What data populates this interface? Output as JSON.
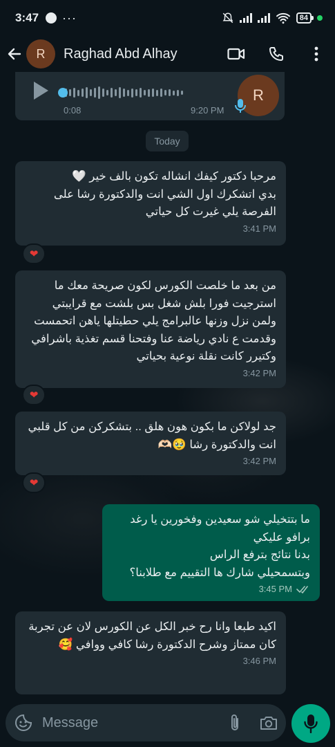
{
  "status_bar": {
    "time": "3:47",
    "dots": "···",
    "battery": "84"
  },
  "header": {
    "contact_name": "Raghad Abd Alhay",
    "avatar_letter": "R"
  },
  "voice_message": {
    "duration": "0:08",
    "time": "9:20 PM",
    "avatar_letter": "R"
  },
  "date_chip": "Today",
  "messages": [
    {
      "direction": "in",
      "text": "مرحبا دكتور كيفك انشاله تكون بالف خير 🤍\nبدي اتشكرك اول الشي انت والدكتورة رشا على الفرصة يلي غيرت كل حياتي",
      "time": "3:41 PM",
      "reaction": "❤"
    },
    {
      "direction": "in",
      "text": "من بعد ما خلصت الكورس لكون صريحة معك ما استرجيت فورا بلش شغل بس بلشت مع قرايبتي ولمن نزل وزنها عالبرامج يلي حطيتلها ياهن اتحمست وقدمت ع نادي رياضة عنا وفتحنا قسم تغذية باشرافي وكتيرر كانت نقلة نوعية بحياتي",
      "time": "3:42 PM",
      "reaction": "❤"
    },
    {
      "direction": "in",
      "text": "جد لولاكن ما بكون هون هلق .. بتشكركن من كل قلبي انت والدكتورة رشا 🥹🫶🏻",
      "time": "3:42 PM",
      "reaction": "❤"
    },
    {
      "direction": "out",
      "text": "ما بتتخيلي شو سعيدين وفخورين يا رغد\nبرافو عليكي\nبدنا نتائج بترفع الراس\nوبتسمحيلي شارك ها التقييم مع طلابنا؟",
      "time": "3:45 PM"
    },
    {
      "direction": "in",
      "text": "اكيد طبعا وانا رح خبر الكل عن الكورس لان عن تجربة كان ممتاز وشرح الدكتورة رشا كافي ووافي 🥰",
      "time": "3:46 PM"
    }
  ],
  "composer": {
    "placeholder": "Message"
  },
  "colors": {
    "background": "#0b141a",
    "incoming_bubble": "#202c33",
    "outgoing_bubble": "#005c4b",
    "accent": "#00a884",
    "reaction_heart": "#e53935"
  }
}
